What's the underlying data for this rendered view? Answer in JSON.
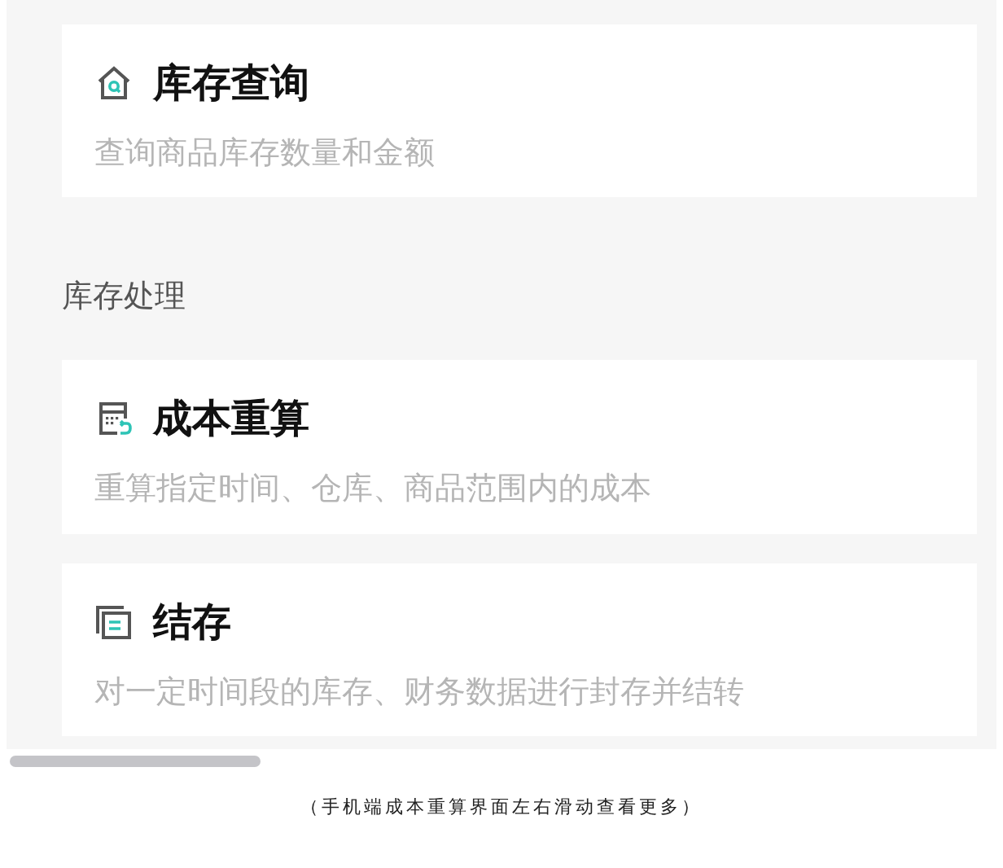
{
  "cards_top": [
    {
      "kind": "query",
      "title": "库存查询",
      "description": "查询商品库存数量和金额"
    }
  ],
  "section": {
    "title": "库存处理"
  },
  "cards": [
    {
      "kind": "recalc",
      "title": "成本重算",
      "description": "重算指定时间、仓库、商品范围内的成本"
    },
    {
      "kind": "close",
      "title": "结存",
      "description": "对一定时间段的库存、财务数据进行封存并结转"
    }
  ],
  "caption": "（手机端成本重算界面左右滑动查看更多）"
}
